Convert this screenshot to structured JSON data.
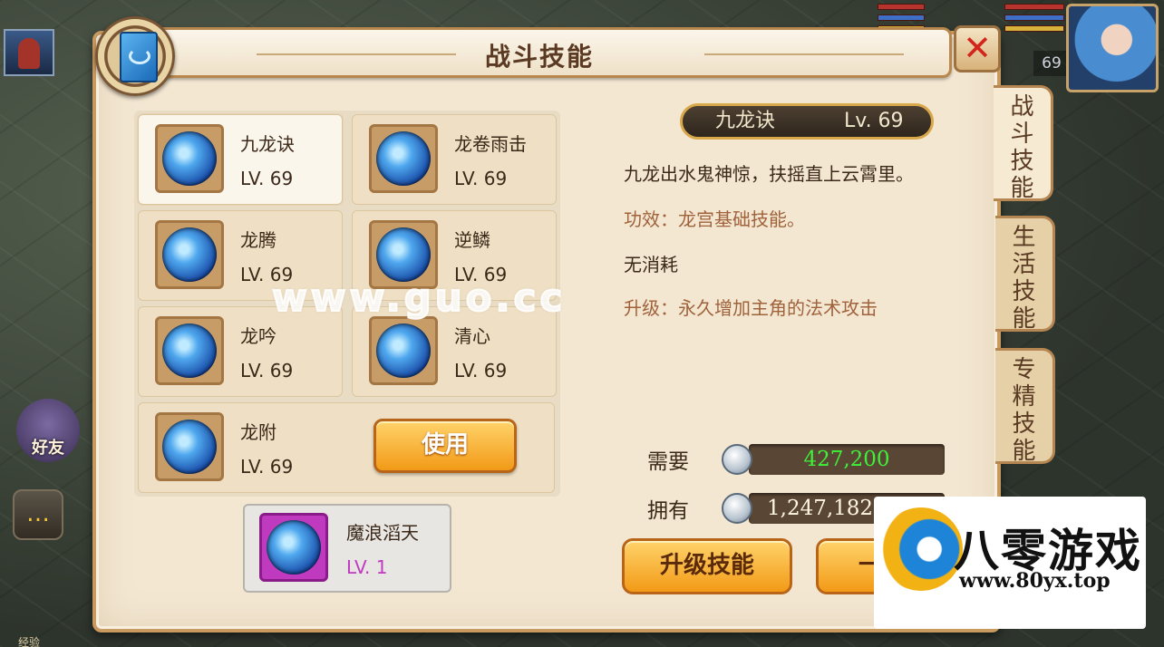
{
  "hud": {
    "player_level": "69",
    "friend_label": "好友",
    "exp_label": "经验"
  },
  "panel": {
    "title": "战斗技能",
    "tabs": [
      {
        "label": [
          "战",
          "斗",
          "技",
          "能"
        ],
        "active": true
      },
      {
        "label": [
          "生",
          "活",
          "技",
          "能"
        ],
        "active": false
      },
      {
        "label": [
          "专",
          "精",
          "技",
          "能"
        ],
        "active": false
      }
    ]
  },
  "skills": [
    {
      "name": "九龙诀",
      "level": "LV. 69"
    },
    {
      "name": "龙卷雨击",
      "level": "LV. 69"
    },
    {
      "name": "龙腾",
      "level": "LV. 69"
    },
    {
      "name": "逆鳞",
      "level": "LV. 69"
    },
    {
      "name": "龙吟",
      "level": "LV. 69"
    },
    {
      "name": "清心",
      "level": "LV. 69"
    },
    {
      "name": "龙附",
      "level": "LV. 69"
    }
  ],
  "use_button": "使用",
  "special_skill": {
    "name": "魔浪滔天",
    "level": "LV. 1"
  },
  "detail": {
    "name": "九龙诀",
    "level": "Lv. 69",
    "description": "九龙出水鬼神惊，扶摇直上云霄里。",
    "effect": "功效：龙宫基础技能。",
    "cost": "无消耗",
    "upgrade": "升级：永久增加主角的法术攻击"
  },
  "currency": {
    "need_label": "需要",
    "need_value": "427,200",
    "own_label": "拥有",
    "own_value": "1,247,182"
  },
  "actions": {
    "upgrade": "升级技能",
    "second": "一"
  },
  "overlay": {
    "watermark": "www.guo.cc",
    "logo_title": "八零游戏",
    "logo_url": "www.80yx.top"
  },
  "colors": {
    "need_value": "#3ef23a",
    "button_orange": "#f29a17",
    "close_red": "#d2261c",
    "special_purple": "#c03ac0"
  }
}
